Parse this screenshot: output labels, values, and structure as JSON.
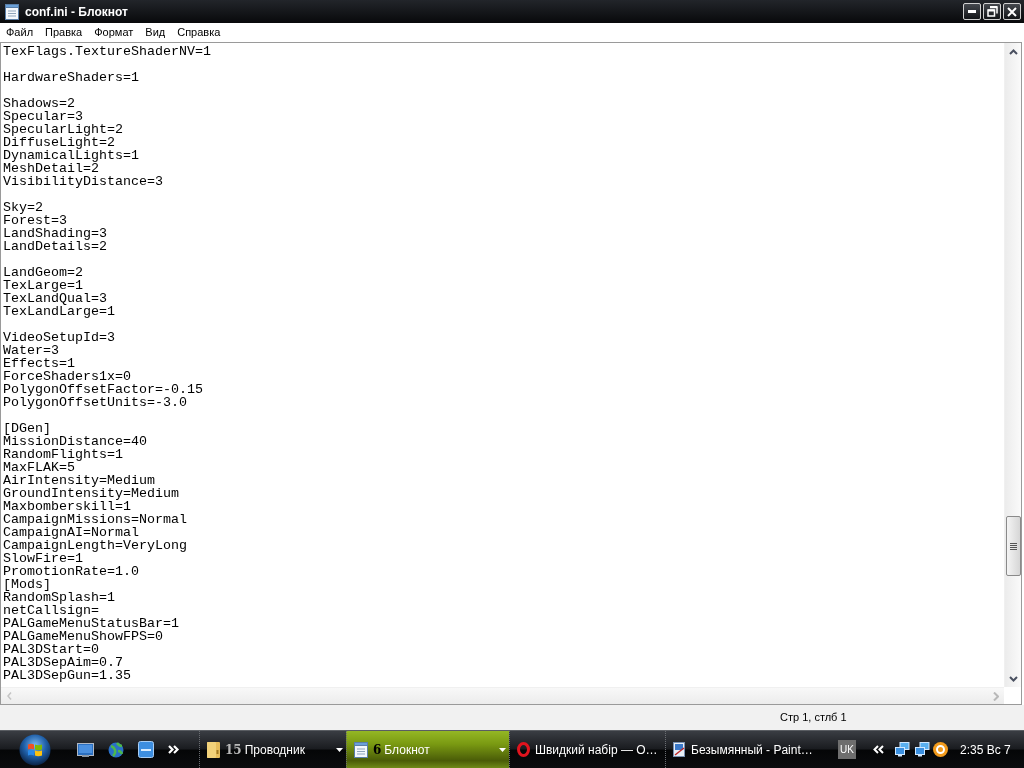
{
  "window": {
    "title": "conf.ini - Блокнот"
  },
  "menu": [
    "Файл",
    "Правка",
    "Формат",
    "Вид",
    "Справка"
  ],
  "editor": {
    "blocks": [
      [
        "TexFlags.TextureShaderNV=1"
      ],
      [
        "HardwareShaders=1"
      ],
      [
        "Shadows=2",
        "Specular=3",
        "SpecularLight=2",
        "DiffuseLight=2",
        "DynamicalLights=1",
        "MeshDetail=2",
        "VisibilityDistance=3"
      ],
      [
        "Sky=2",
        "Forest=3",
        "LandShading=3",
        "LandDetails=2"
      ],
      [
        "LandGeom=2",
        "TexLarge=1",
        "TexLandQual=3",
        "TexLandLarge=1"
      ],
      [
        "VideoSetupId=3",
        "Water=3",
        "Effects=1",
        "ForceShaders1x=0",
        "PolygonOffsetFactor=-0.15",
        "PolygonOffsetUnits=-3.0"
      ],
      [
        "[DGen]",
        "MissionDistance=40",
        "RandomFlights=1",
        "MaxFLAK=5",
        "AirIntensity=Medium",
        "GroundIntensity=Medium",
        "Maxbomberskill=1",
        "CampaignMissions=Normal",
        "CampaignAI=Normal",
        "CampaignLength=VeryLong",
        "SlowFire=1",
        "PromotionRate=1.0",
        "[Mods]",
        "RandomSplash=1",
        "netCallsign=",
        "PALGameMenuStatusBar=1",
        "PALGameMenuShowFPS=0",
        "PAL3DStart=0",
        "PAL3DSepAim=0.7",
        "PAL3DSepGun=1.35"
      ]
    ]
  },
  "status_bar": {
    "position": "Стр 1, стлб 1"
  },
  "taskbar": {
    "tasks": [
      {
        "kind": "folder",
        "count": "15",
        "label": "Проводник",
        "selected": false
      },
      {
        "kind": "notepad",
        "count": "6",
        "label": "Блокнот",
        "selected": true
      },
      {
        "kind": "ring",
        "label": "Швидкий набір — О…",
        "selected": false
      },
      {
        "kind": "picture",
        "label": "Безымянный - Paint…",
        "selected": false
      }
    ],
    "language": "UK",
    "clock": "2:35 Вс 7"
  }
}
